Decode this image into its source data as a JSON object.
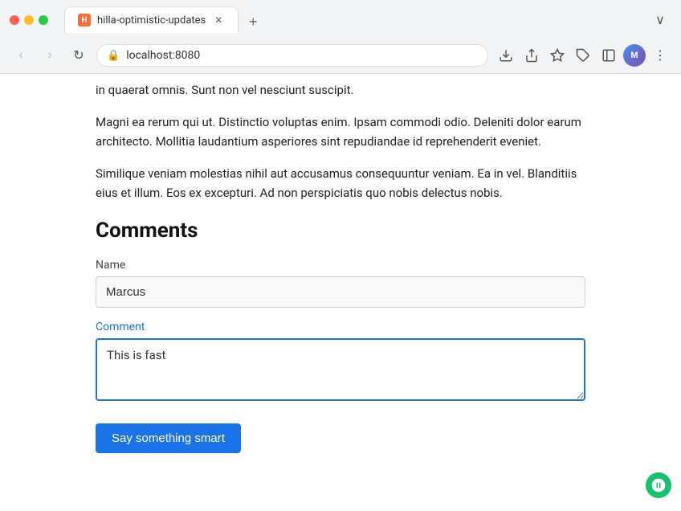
{
  "browser": {
    "tab_title": "hilla-optimistic-updates",
    "tab_favicon_letter": "H",
    "url": "localhost:8080",
    "new_tab_label": "+",
    "nav": {
      "back_label": "‹",
      "forward_label": "›",
      "refresh_label": "↻"
    },
    "toolbar": {
      "download_label": "⬇",
      "share_label": "⬆",
      "bookmark_label": "☆",
      "extensions_label": "⊞",
      "sidebar_label": "▣",
      "menu_label": "⋮",
      "chevron_label": "∨"
    }
  },
  "page": {
    "article": {
      "paragraph1": "in quaerat omnis. Sunt non vel nesciunt suscipit.",
      "paragraph2": "Magni ea rerum qui ut. Distinctio voluptas enim. Ipsam commodi odio. Deleniti dolor earum architecto. Mollitia laudantium asperiores sint repudiandae id reprehenderit eveniet.",
      "paragraph3": "Similique veniam molestias nihil aut accusamus consequuntur veniam. Ea in vel. Blanditiis eius et illum. Eos ex excepturi. Ad non perspiciatis quo nobis delectus nobis."
    },
    "comments": {
      "heading": "Comments",
      "name_label": "Name",
      "name_value": "Marcus",
      "name_placeholder": "",
      "comment_label": "Comment",
      "comment_value": "This is fast",
      "comment_placeholder": "",
      "submit_label": "Say something smart"
    }
  },
  "extension": {
    "name": "Grammarly"
  }
}
